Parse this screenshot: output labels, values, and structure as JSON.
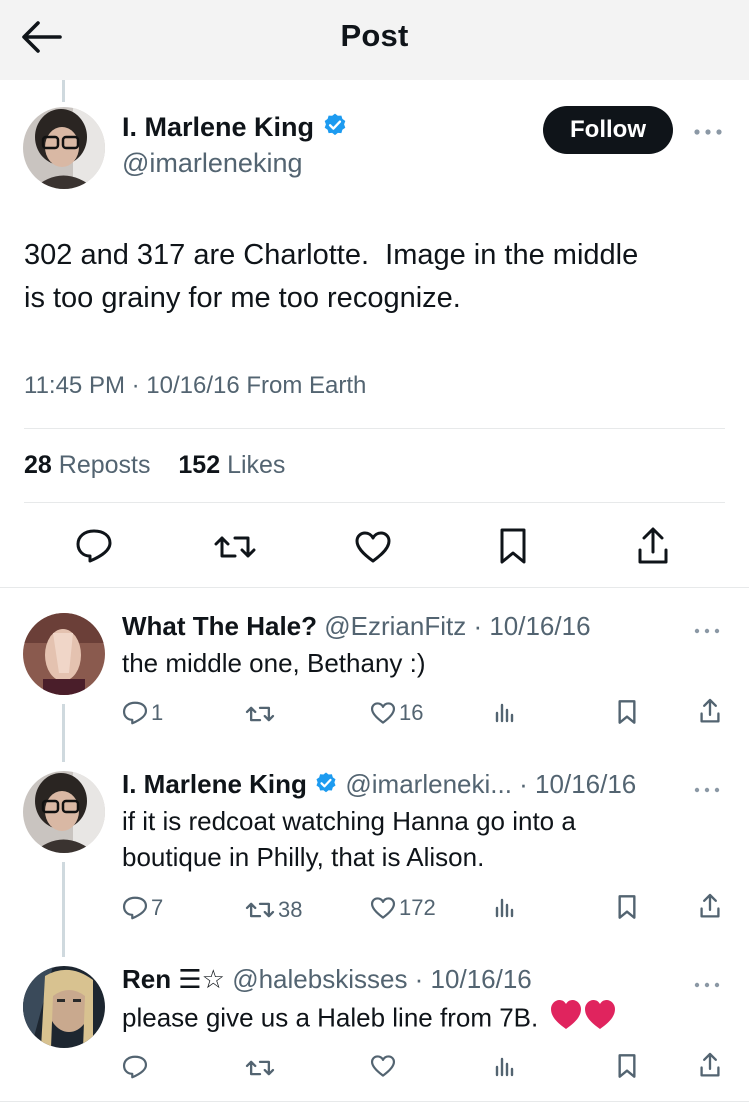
{
  "header": {
    "title": "Post"
  },
  "post": {
    "author_name": "I. Marlene King",
    "author_handle": "@imarleneking",
    "follow_label": "Follow",
    "text": "302 and 317 are Charlotte.  Image in the middle\nis too grainy for me too recognize.",
    "meta": "11:45 PM · 10/16/16 From Earth",
    "reposts_count": "28",
    "reposts_label": "Reposts",
    "likes_count": "152",
    "likes_label": "Likes"
  },
  "replies": [
    {
      "name": "What The Hale?",
      "handle_date": "@EzrianFitz · 10/16/16",
      "text": "the middle one, Bethany :)",
      "reply_count": "1",
      "repost_count": "",
      "like_count": "16"
    },
    {
      "name": "I. Marlene King",
      "handle_date": "@imarleneki... · 10/16/16",
      "text": "if it is redcoat watching Hanna go into a\nboutique in Philly, that is Alison.",
      "reply_count": "7",
      "repost_count": "38",
      "like_count": "172"
    },
    {
      "name": "Ren ☰☆",
      "handle_date": "@halebskisses · 10/16/16",
      "text": "please give us a Haleb line from 7B.",
      "reply_count": "",
      "repost_count": "",
      "like_count": ""
    }
  ],
  "icons": {
    "back": "arrow-left-icon",
    "verified": "verified-badge-icon",
    "more": "more-dots-icon",
    "reply": "reply-icon",
    "repost": "repost-icon",
    "like": "heart-icon",
    "views": "views-icon",
    "bookmark": "bookmark-icon",
    "share": "share-icon"
  },
  "colors": {
    "verified": "#1d9bf0",
    "heart_emoji": "#e0245e",
    "text": "#0f1419",
    "muted": "#536471"
  }
}
